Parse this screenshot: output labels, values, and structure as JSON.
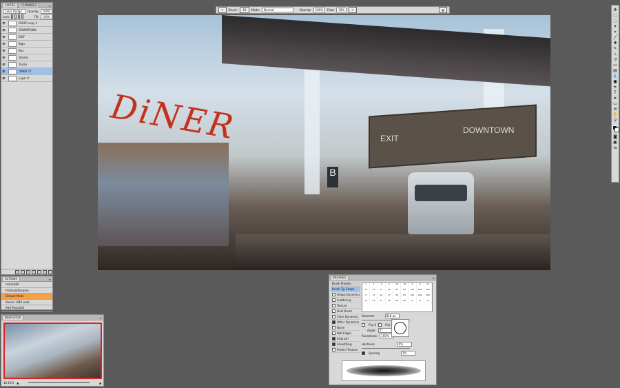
{
  "layers_panel": {
    "tabs": [
      "LAYERS",
      "CHANNELS"
    ],
    "blend_mode": "Color Dodge",
    "opacity_label": "Opacity:",
    "opacity_value": "100%",
    "lock_label": "Lock:",
    "fill_label": "Fill:",
    "fill_value": "100%",
    "layers": [
      {
        "name": "PERSP copy 2",
        "selected": false
      },
      {
        "name": "DOWNTOWN",
        "selected": false
      },
      {
        "name": "EXIT",
        "selected": false
      },
      {
        "name": "Sign",
        "selected": false
      },
      {
        "name": "Bus",
        "selected": false
      },
      {
        "name": "Details",
        "selected": false
      },
      {
        "name": "Trucks",
        "selected": false
      },
      {
        "name": "DINER YT",
        "selected": true
      },
      {
        "name": "Layer 0",
        "selected": false
      }
    ]
  },
  "actions_panel": {
    "tab": "ACTIONS",
    "items": [
      "resize480",
      "Flatten&Sharpen",
      "Default Mode",
      "Resize 1440 wide",
      "Add Props2x4"
    ],
    "highlighted_index": 2
  },
  "navigator_panel": {
    "tab": "NAVIGATOR",
    "zoom": "16.13%"
  },
  "options_bar": {
    "brush_label": "Brush:",
    "brush_size": "19",
    "mode_label": "Mode:",
    "mode_value": "Normal",
    "opacity_label": "Opacity:",
    "opacity_value": "100%",
    "flow_label": "Flow:",
    "flow_value": "39%"
  },
  "canvas": {
    "diner_text": "DiNER",
    "exit_text": "EXIT",
    "downtown_text": "DOWNTOWN",
    "bus_stop_letter": "B"
  },
  "toolbox": {
    "icons": [
      "move-icon",
      "marquee-icon",
      "lasso-icon",
      "magic-wand-icon",
      "crop-icon",
      "eyedropper-icon",
      "healing-icon",
      "brush-icon",
      "clone-stamp-icon",
      "history-brush-icon",
      "eraser-icon",
      "gradient-icon",
      "blur-icon",
      "dodge-icon",
      "pen-icon",
      "type-icon",
      "path-select-icon",
      "shape-icon",
      "notes-icon",
      "hand-icon",
      "zoom-icon"
    ],
    "foreground_color": "#111111",
    "background_color": "#ffffff"
  },
  "brushes_panel": {
    "tab": "BRUSHES",
    "items": [
      {
        "label": "Brush Presets",
        "checkbox": false,
        "checked": false
      },
      {
        "label": "Brush Tip Shape",
        "checkbox": false,
        "checked": false
      },
      {
        "label": "Shape Dynamics",
        "checkbox": true,
        "checked": false
      },
      {
        "label": "Scattering",
        "checkbox": true,
        "checked": false
      },
      {
        "label": "Texture",
        "checkbox": true,
        "checked": false
      },
      {
        "label": "Dual Brush",
        "checkbox": true,
        "checked": false
      },
      {
        "label": "Color Dynamics",
        "checkbox": true,
        "checked": false
      },
      {
        "label": "Other Dynamics",
        "checkbox": true,
        "checked": true
      },
      {
        "label": "Noise",
        "checkbox": true,
        "checked": false
      },
      {
        "label": "Wet Edges",
        "checkbox": true,
        "checked": false
      },
      {
        "label": "Airbrush",
        "checkbox": true,
        "checked": true
      },
      {
        "label": "Smoothing",
        "checkbox": true,
        "checked": true
      },
      {
        "label": "Protect Texture",
        "checkbox": true,
        "checked": false
      }
    ],
    "tip_sizes": [
      "1",
      "3",
      "5",
      "9",
      "13",
      "19",
      "5",
      "9",
      "13",
      "17",
      "21",
      "27",
      "35",
      "45",
      "65",
      "100",
      "200",
      "300",
      "9",
      "13",
      "19",
      "17",
      "45",
      "65",
      "100",
      "200",
      "300",
      "14",
      "24",
      "27",
      "39",
      "46",
      "59",
      "11",
      "17",
      "23"
    ],
    "diameter_label": "Diameter",
    "diameter_value": "818 px",
    "flip_x": "Flip X",
    "flip_y": "Flip Y",
    "angle_label": "Angle:",
    "angle_value": "0°",
    "roundness_label": "Roundness:",
    "roundness_value": "100%",
    "hardness_label": "Hardness",
    "hardness_value": "0%",
    "spacing_label": "Spacing",
    "spacing_value": "1%"
  }
}
